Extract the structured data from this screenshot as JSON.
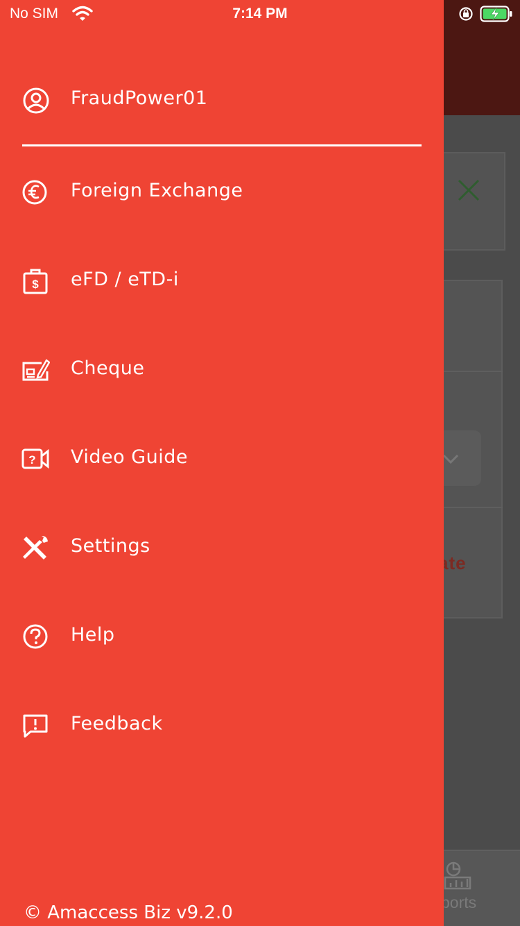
{
  "status_bar": {
    "carrier": "No SIM",
    "time": "7:14 PM"
  },
  "background": {
    "partial_text": "ate",
    "tab_label_partial": "ports"
  },
  "drawer": {
    "username": "FraudPower01",
    "items": [
      {
        "label": "Foreign Exchange",
        "icon": "euro-icon"
      },
      {
        "label": "eFD / eTD-i",
        "icon": "deposit-icon"
      },
      {
        "label": "Cheque",
        "icon": "cheque-icon"
      },
      {
        "label": "Video Guide",
        "icon": "video-guide-icon"
      },
      {
        "label": "Settings",
        "icon": "settings-icon"
      },
      {
        "label": "Help",
        "icon": "help-icon"
      },
      {
        "label": "Feedback",
        "icon": "feedback-icon"
      }
    ],
    "version": "© Amaccess Biz v9.2.0"
  },
  "colors": {
    "drawer": "#ef4434",
    "overlay_header": "#4c1712",
    "overlay_body": "#4b4b4b",
    "text": "#ffffff"
  }
}
